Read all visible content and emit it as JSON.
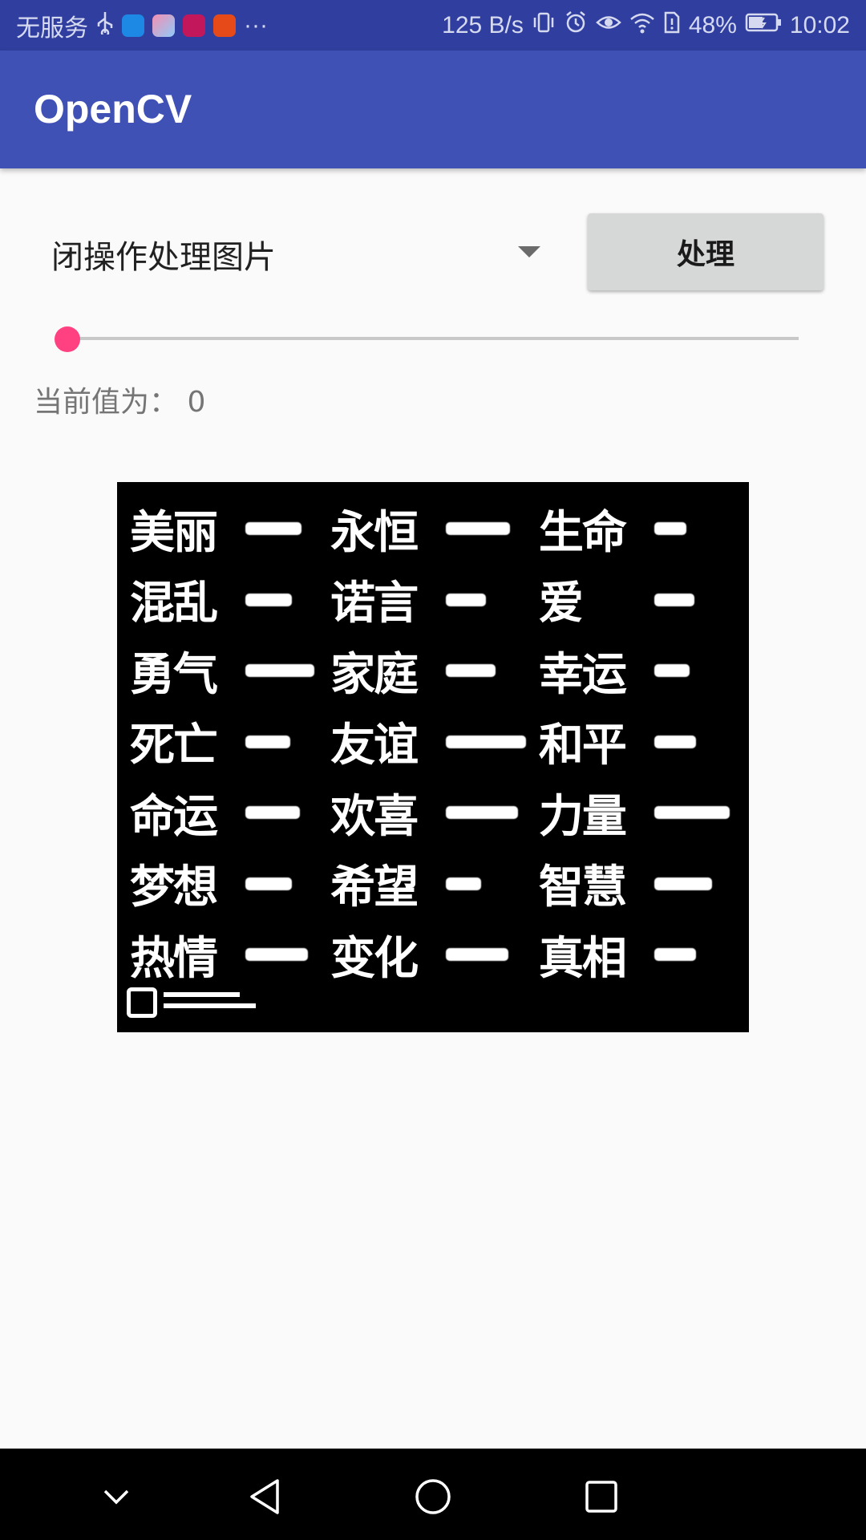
{
  "status_bar": {
    "carrier": "无服务",
    "more": "···",
    "network_speed": "125 B/s",
    "battery_percent": "48%",
    "time": "10:02"
  },
  "toolbar": {
    "title": "OpenCV"
  },
  "controls": {
    "spinner_selected": "闭操作处理图片",
    "process_button_label": "处理",
    "slider_value": 0,
    "current_value_text": "当前值为： 0"
  },
  "image": {
    "rows": [
      [
        "美丽",
        "永恒",
        "生命"
      ],
      [
        "混乱",
        "诺言",
        "爱"
      ],
      [
        "勇气",
        "家庭",
        "幸运"
      ],
      [
        "死亡",
        "友谊",
        "和平"
      ],
      [
        "命运",
        "欢喜",
        "力量"
      ],
      [
        "梦想",
        "希望",
        "智慧"
      ],
      [
        "热情",
        "变化",
        "真相"
      ]
    ]
  },
  "colors": {
    "status_bar": "#303f9f",
    "toolbar": "#3f51b5",
    "accent": "#ff4081",
    "button": "#d6d7d7"
  },
  "nav": {
    "icons": [
      "chevron-down-icon",
      "back-icon",
      "home-icon",
      "recents-icon"
    ]
  }
}
